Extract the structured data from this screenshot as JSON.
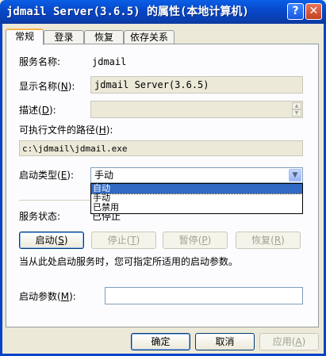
{
  "window": {
    "title": "jdmail Server(3.6.5) 的属性(本地计算机)",
    "help_btn": "?",
    "close_btn": "✕"
  },
  "tabs": [
    "常规",
    "登录",
    "恢复",
    "依存关系"
  ],
  "general": {
    "service_name_label": "服务名称:",
    "service_name_value": "jdmail",
    "display_name_label": "显示名称",
    "display_name_key": "N",
    "display_name_value": "jdmail Server(3.6.5)",
    "description_label": "描述",
    "description_key": "D",
    "path_label": "可执行文件的路径",
    "path_key": "H",
    "path_value": "c:\\jdmail\\jdmail.exe",
    "startup_type_label": "启动类型",
    "startup_type_key": "E",
    "startup_type_value": "手动",
    "startup_options": [
      "自动",
      "手动",
      "已禁用"
    ],
    "startup_selected_index": 0,
    "status_label": "服务状态:",
    "status_value": "已停止",
    "start_btn": "启动",
    "start_key": "S",
    "stop_btn": "停止",
    "stop_key": "T",
    "pause_btn": "暂停",
    "pause_key": "P",
    "resume_btn": "恢复",
    "resume_key": "R",
    "hint": "当从此处启动服务时，您可指定所适用的启动参数。",
    "params_label": "启动参数",
    "params_key": "M",
    "params_value": ""
  },
  "footer": {
    "ok": "确定",
    "cancel": "取消",
    "apply": "应用",
    "apply_key": "A"
  }
}
